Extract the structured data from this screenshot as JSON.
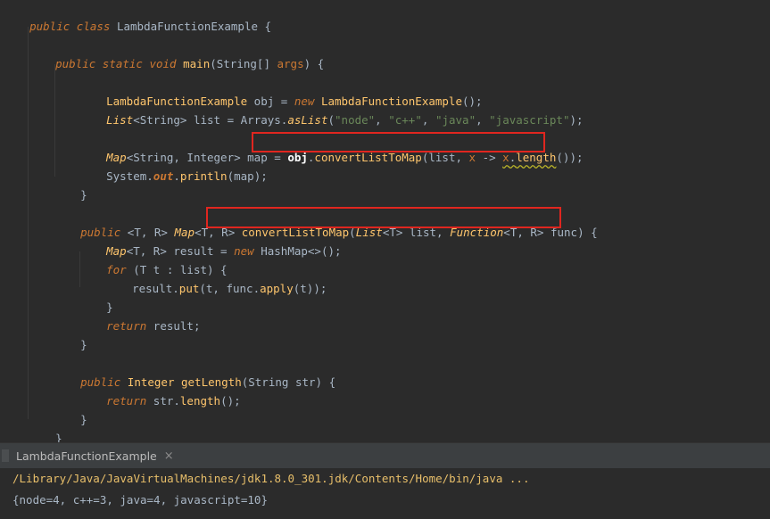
{
  "editor": {
    "lines": {
      "l1": {
        "kw1": "public",
        "kw2": "class",
        "name": "LambdaFunctionExample",
        "brace": " {"
      },
      "l3": {
        "kw1": "public",
        "kw2": "static",
        "kw3": "void",
        "name": "main",
        "rest1": "(String[] ",
        "arg": "args",
        "rest2": ") {"
      },
      "l5": {
        "type": "LambdaFunctionExample",
        "var": " obj = ",
        "kw": "new",
        "ctor": " LambdaFunctionExample",
        "end": "();"
      },
      "l6": {
        "type": "List",
        "gen": "<String>",
        "var": " list = Arrays.",
        "meth": "asList",
        "open": "(",
        "s1": "\"node\"",
        "c1": ", ",
        "s2": "\"c++\"",
        "c2": ", ",
        "s3": "\"java\"",
        "c3": ", ",
        "s4": "\"javascript\"",
        "end": ");"
      },
      "l8": {
        "type": "Map",
        "gen": "<String, Integer>",
        "var": " map = ",
        "obj": "obj",
        "dot": ".",
        "meth": "convertListToMap",
        "args1": "(list, ",
        "x": "x",
        "arrow": " -> ",
        "x2": "x",
        "dot2": ".",
        "len": "length",
        "end": "());"
      },
      "l9": {
        "sys": "System.",
        "out": "out",
        "dot": ".",
        "meth": "println",
        "args": "(map);"
      },
      "l10": {
        "brace": "}"
      },
      "l12": {
        "kw": "public",
        "g1": " <T, R> ",
        "type": "Map",
        "g2": "<T, R> ",
        "name": "convertListToMap",
        "p1": "(",
        "ptype": "List",
        "pgen": "<T> list, ",
        "ftype": "Function",
        "fgen": "<T, R> func) {"
      },
      "l13": {
        "type": "Map",
        "gen": "<T, R> result = ",
        "kw": "new",
        "rest": " HashMap<>();"
      },
      "l14": {
        "kw": "for",
        "rest": " (T t : list) {"
      },
      "l15": {
        "obj": "result.",
        "meth": "put",
        "mid": "(t, func.",
        "meth2": "apply",
        "end": "(t));"
      },
      "l16": {
        "brace": "}"
      },
      "l17": {
        "kw": "return",
        "rest": " result;"
      },
      "l18": {
        "brace": "}"
      },
      "l20": {
        "kw": "public",
        "type": " Integer ",
        "name": "getLength",
        "rest": "(String str) {"
      },
      "l21": {
        "kw": "return",
        "obj": " str.",
        "meth": "length",
        "end": "();"
      },
      "l22": {
        "brace": "}"
      },
      "l23": {
        "brace": "}"
      }
    }
  },
  "run_panel": {
    "tab_label": "LambdaFunctionExample",
    "close_glyph": "×",
    "path_line": "/Library/Java/JavaVirtualMachines/jdk1.8.0_301.jdk/Contents/Home/bin/java ...",
    "output_line": "{node=4, c++=3, java=4, javascript=10}"
  },
  "colors": {
    "background": "#2b2b2b",
    "keyword": "#cc7832",
    "method": "#ffc66d",
    "string": "#6a8759",
    "text": "#a9b7c6",
    "highlight_box": "#e0261f"
  }
}
